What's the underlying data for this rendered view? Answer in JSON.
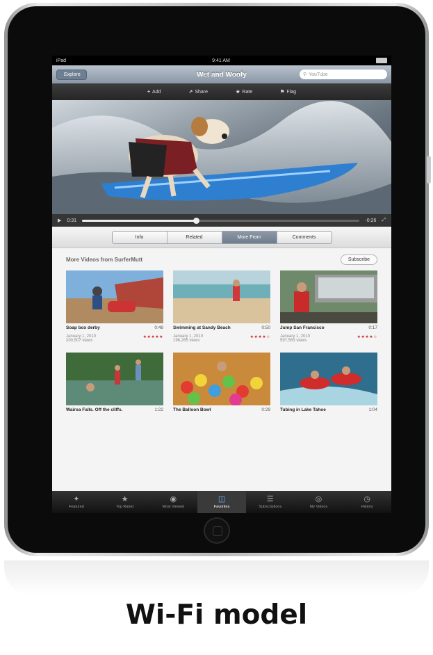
{
  "status_bar": {
    "carrier": "iPad",
    "time": "9:41 AM"
  },
  "nav": {
    "back_label": "Explore",
    "title": "Wet and Woofy",
    "search_placeholder": "YouTube"
  },
  "actions": [
    {
      "icon": "plus-icon",
      "label": "Add"
    },
    {
      "icon": "share-icon",
      "label": "Share"
    },
    {
      "icon": "star-icon",
      "label": "Rate"
    },
    {
      "icon": "flag-icon",
      "label": "Flag"
    }
  ],
  "player": {
    "elapsed": "0:31",
    "remaining": "-0:26",
    "progress": 0.41
  },
  "segments": {
    "items": [
      "Info",
      "Related",
      "More From",
      "Comments"
    ],
    "active": 2
  },
  "more": {
    "title": "More Videos from SurferMutt",
    "subscribe": "Subscribe"
  },
  "videos": [
    {
      "title": "Soap box derby",
      "duration": "0:48",
      "date": "January 1, 2010",
      "views": "200,507 views",
      "stars": "★★★★★"
    },
    {
      "title": "Swimming at Sandy Beach",
      "duration": "0:50",
      "date": "January 1, 2010",
      "views": "196,265 views",
      "stars": "★★★★☆"
    },
    {
      "title": "Jump San Francisco",
      "duration": "0:17",
      "date": "January 1, 2010",
      "views": "597,563 views",
      "stars": "★★★★☆"
    },
    {
      "title": "Wairoa Falls. Off the cliffs.",
      "duration": "1:22",
      "date": "",
      "views": "",
      "stars": ""
    },
    {
      "title": "The Balloon Bowl",
      "duration": "0:29",
      "date": "",
      "views": "",
      "stars": ""
    },
    {
      "title": "Tubing in Lake Tahoe",
      "duration": "1:04",
      "date": "",
      "views": "",
      "stars": ""
    }
  ],
  "tabs": {
    "items": [
      {
        "icon": "featured-icon",
        "label": "Featured"
      },
      {
        "icon": "star-icon",
        "label": "Top Rated"
      },
      {
        "icon": "most-viewed-icon",
        "label": "Most Viewed"
      },
      {
        "icon": "favorites-icon",
        "label": "Favorites"
      },
      {
        "icon": "subscriptions-icon",
        "label": "Subscriptions"
      },
      {
        "icon": "my-videos-icon",
        "label": "My Videos"
      },
      {
        "icon": "history-icon",
        "label": "History"
      }
    ],
    "active": 3
  },
  "caption": "Wi-Fi model"
}
